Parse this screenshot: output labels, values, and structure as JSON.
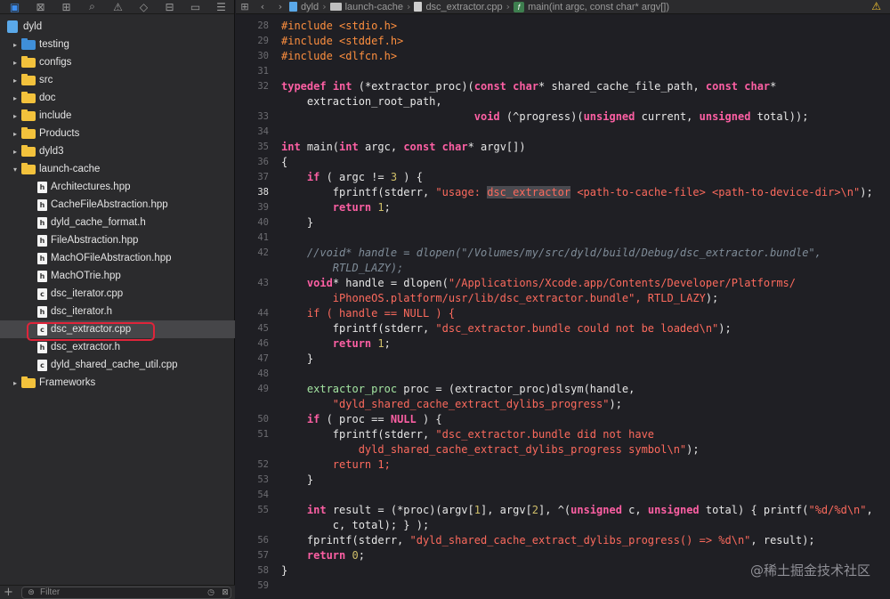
{
  "sidebar": {
    "toolbar_icons": [
      "folder-icon",
      "source-control-icon",
      "symbol-icon",
      "find-icon",
      "issue-icon",
      "test-icon",
      "debug-icon",
      "breakpoint-icon",
      "report-icon"
    ],
    "project": "dyld",
    "items": [
      {
        "label": "testing",
        "kind": "folder-blue"
      },
      {
        "label": "configs",
        "kind": "folder"
      },
      {
        "label": "src",
        "kind": "folder"
      },
      {
        "label": "doc",
        "kind": "folder"
      },
      {
        "label": "include",
        "kind": "folder"
      },
      {
        "label": "Products",
        "kind": "folder"
      },
      {
        "label": "dyld3",
        "kind": "folder"
      },
      {
        "label": "launch-cache",
        "kind": "folder-open"
      },
      {
        "label": "Architectures.hpp",
        "kind": "h"
      },
      {
        "label": "CacheFileAbstraction.hpp",
        "kind": "h"
      },
      {
        "label": "dyld_cache_format.h",
        "kind": "h"
      },
      {
        "label": "FileAbstraction.hpp",
        "kind": "h"
      },
      {
        "label": "MachOFileAbstraction.hpp",
        "kind": "h"
      },
      {
        "label": "MachOTrie.hpp",
        "kind": "h"
      },
      {
        "label": "dsc_iterator.cpp",
        "kind": "c"
      },
      {
        "label": "dsc_iterator.h",
        "kind": "h"
      },
      {
        "label": "dsc_extractor.cpp",
        "kind": "c",
        "selected": true
      },
      {
        "label": "dsc_extractor.h",
        "kind": "h"
      },
      {
        "label": "dyld_shared_cache_util.cpp",
        "kind": "c"
      },
      {
        "label": "Frameworks",
        "kind": "folder"
      }
    ],
    "filter_placeholder": "Filter"
  },
  "jumpbar": {
    "crumbs": [
      "dyld",
      "launch-cache",
      "dsc_extractor.cpp",
      "main(int argc, const char* argv[])"
    ]
  },
  "editor": {
    "lines": [
      {
        "n": "28",
        "t": "#include <stdio.h>"
      },
      {
        "n": "29",
        "t": "#include <stddef.h>"
      },
      {
        "n": "30",
        "t": "#include <dlfcn.h>"
      },
      {
        "n": "31",
        "t": ""
      },
      {
        "n": "32",
        "t": "typedef int (*extractor_proc)(const char* shared_cache_file_path, const char*"
      },
      {
        "n": "",
        "t": "    extraction_root_path,"
      },
      {
        "n": "33",
        "t": "                              void (^progress)(unsigned current, unsigned total));"
      },
      {
        "n": "34",
        "t": ""
      },
      {
        "n": "35",
        "t": "int main(int argc, const char* argv[])"
      },
      {
        "n": "36",
        "t": "{"
      },
      {
        "n": "37",
        "t": "    if ( argc != 3 ) {"
      },
      {
        "n": "38",
        "t": "        fprintf(stderr, \"usage: dsc_extractor <path-to-cache-file> <path-to-device-dir>\\n\");"
      },
      {
        "n": "39",
        "t": "        return 1;"
      },
      {
        "n": "40",
        "t": "    }"
      },
      {
        "n": "41",
        "t": ""
      },
      {
        "n": "42",
        "t": "    //void* handle = dlopen(\"/Volumes/my/src/dyld/build/Debug/dsc_extractor.bundle\","
      },
      {
        "n": "",
        "t": "        RTLD_LAZY);"
      },
      {
        "n": "43",
        "t": "    void* handle = dlopen(\"/Applications/Xcode.app/Contents/Developer/Platforms/"
      },
      {
        "n": "",
        "t": "        iPhoneOS.platform/usr/lib/dsc_extractor.bundle\", RTLD_LAZY);"
      },
      {
        "n": "44",
        "t": "    if ( handle == NULL ) {"
      },
      {
        "n": "45",
        "t": "        fprintf(stderr, \"dsc_extractor.bundle could not be loaded\\n\");"
      },
      {
        "n": "46",
        "t": "        return 1;"
      },
      {
        "n": "47",
        "t": "    }"
      },
      {
        "n": "48",
        "t": ""
      },
      {
        "n": "49",
        "t": "    extractor_proc proc = (extractor_proc)dlsym(handle,"
      },
      {
        "n": "",
        "t": "        \"dyld_shared_cache_extract_dylibs_progress\");"
      },
      {
        "n": "50",
        "t": "    if ( proc == NULL ) {"
      },
      {
        "n": "51",
        "t": "        fprintf(stderr, \"dsc_extractor.bundle did not have"
      },
      {
        "n": "",
        "t": "            dyld_shared_cache_extract_dylibs_progress symbol\\n\");"
      },
      {
        "n": "52",
        "t": "        return 1;"
      },
      {
        "n": "53",
        "t": "    }"
      },
      {
        "n": "54",
        "t": ""
      },
      {
        "n": "55",
        "t": "    int result = (*proc)(argv[1], argv[2], ^(unsigned c, unsigned total) { printf(\"%d/%d\\n\","
      },
      {
        "n": "",
        "t": "        c, total); } );"
      },
      {
        "n": "56",
        "t": "    fprintf(stderr, \"dyld_shared_cache_extract_dylibs_progress() => %d\\n\", result);"
      },
      {
        "n": "57",
        "t": "    return 0;"
      },
      {
        "n": "58",
        "t": "}"
      },
      {
        "n": "59",
        "t": ""
      }
    ],
    "current_line": "38",
    "highlight_word": "dsc_extractor"
  },
  "watermark": "@稀土掘金技术社区",
  "colors": {
    "keyword": "#fc5fa3",
    "preprocessor": "#fd8f3f",
    "string": "#fc6a5d",
    "number": "#d0bf69",
    "comment": "#7f8c98",
    "type": "#a3e4a1",
    "selection_ring": "#e0243a",
    "warning": "#f2c230"
  }
}
